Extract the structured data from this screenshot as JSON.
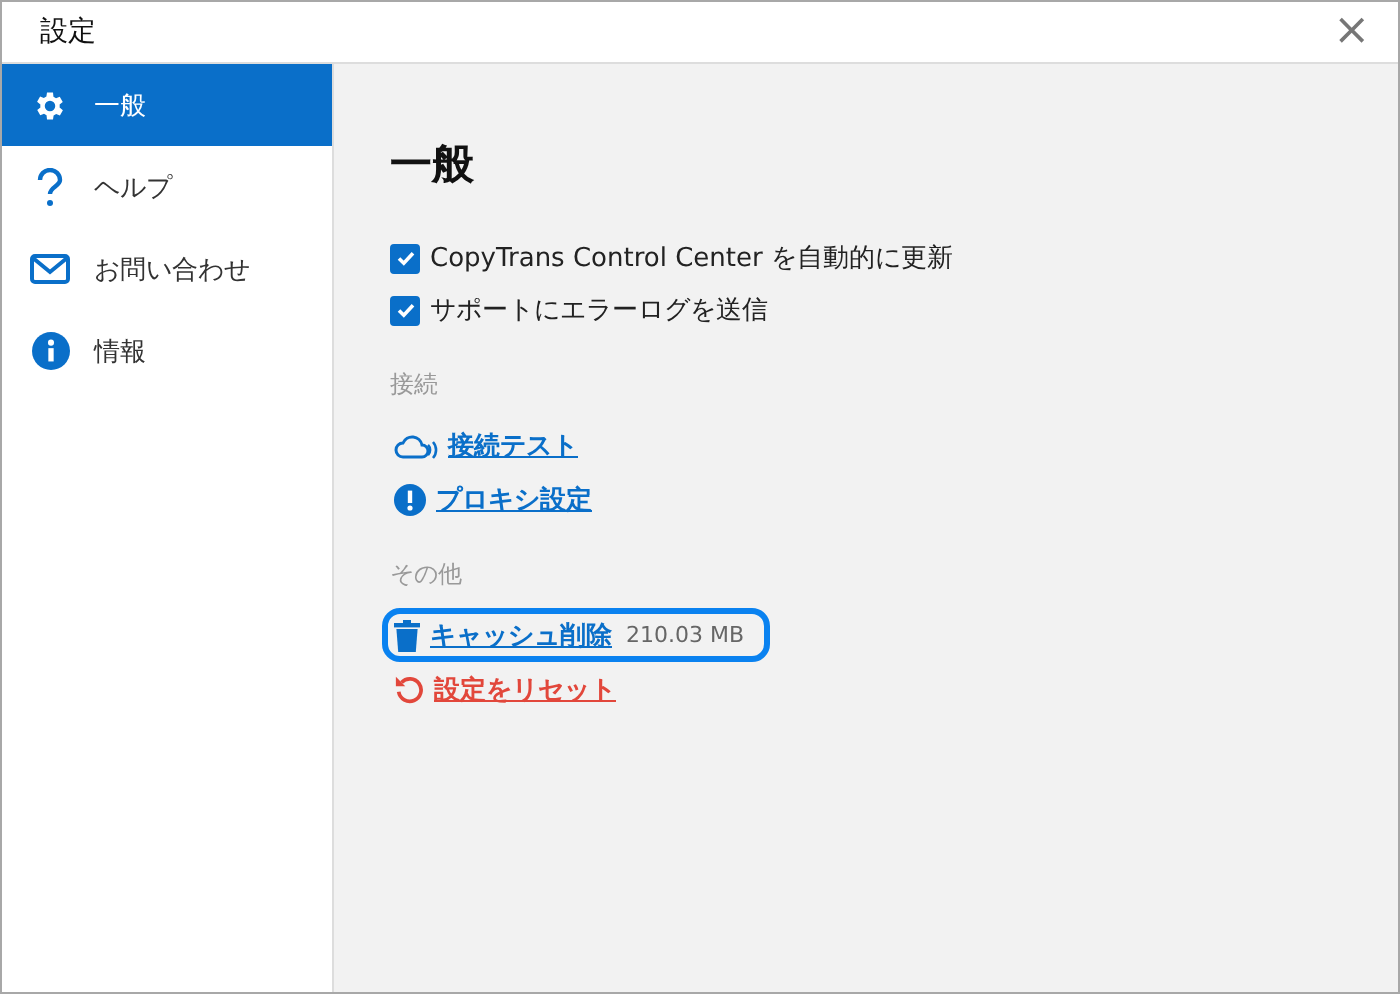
{
  "window": {
    "title": "設定",
    "close": "×"
  },
  "sidebar": {
    "items": [
      {
        "label": "一般",
        "selected": true
      },
      {
        "label": "ヘルプ",
        "selected": false
      },
      {
        "label": "お問い合わせ",
        "selected": false
      },
      {
        "label": "情報",
        "selected": false
      }
    ]
  },
  "heading": "一般",
  "options": [
    {
      "label": "CopyTrans Control Center を自動的に更新",
      "checked": true
    },
    {
      "label": "サポートにエラーログを送信",
      "checked": true
    }
  ],
  "sections": [
    {
      "title": "接続",
      "links": [
        {
          "label": "接続テスト",
          "kind": "normal",
          "highlighted": false
        },
        {
          "label": "プロキシ設定",
          "kind": "normal",
          "highlighted": false
        }
      ]
    },
    {
      "title": "その他",
      "links": [
        {
          "label": "キャッシュ削除",
          "size": "210.03 MB",
          "kind": "normal",
          "highlighted": true
        },
        {
          "label": "設定をリセット",
          "kind": "danger",
          "highlighted": false
        }
      ]
    }
  ]
}
